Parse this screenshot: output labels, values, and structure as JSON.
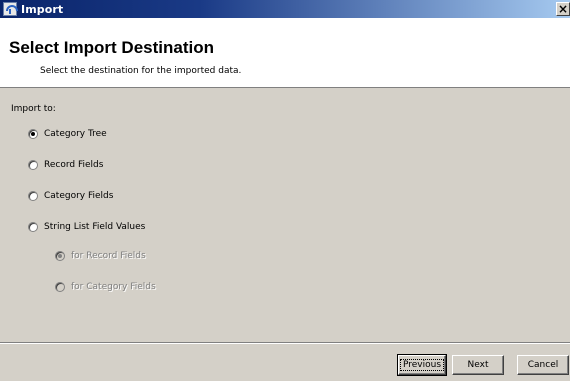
{
  "window": {
    "title": "Import"
  },
  "titlebar": {
    "close_glyph": "×",
    "icon": "import-icon"
  },
  "header": {
    "title": "Select Import Destination",
    "subtitle": "Select the destination for the imported data."
  },
  "content": {
    "import_to_label": "Import to:",
    "options": [
      {
        "label": "Category Tree",
        "checked": true,
        "enabled": true
      },
      {
        "label": "Record Fields",
        "checked": false,
        "enabled": true
      },
      {
        "label": "Category Fields",
        "checked": false,
        "enabled": true
      },
      {
        "label": "String List Field Values",
        "checked": false,
        "enabled": true
      }
    ],
    "sub_options": [
      {
        "label": "for Record Fields",
        "checked": true,
        "enabled": false
      },
      {
        "label": "for Category Fields",
        "checked": false,
        "enabled": false
      }
    ]
  },
  "footer": {
    "previous_label": "Previous",
    "next_label": "Next",
    "cancel_label": "Cancel"
  },
  "colors": {
    "titlebar_start": "#0a246a",
    "titlebar_end": "#a6caf0",
    "dialog_bg": "#d4d0c8",
    "header_bg": "#ffffff"
  }
}
